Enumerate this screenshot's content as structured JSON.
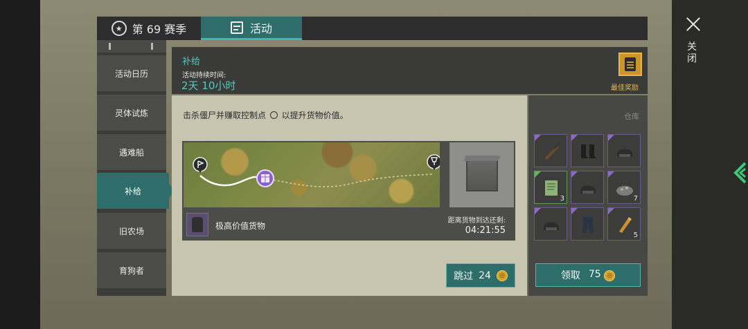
{
  "tabs": {
    "season_label": "第 69 赛季",
    "activity_label": "活动"
  },
  "sidebar": {
    "items": [
      {
        "label": "活动日历"
      },
      {
        "label": "灵体试炼"
      },
      {
        "label": "遇难船"
      },
      {
        "label": "补给"
      },
      {
        "label": "旧农场"
      },
      {
        "label": "育狗者"
      }
    ],
    "active": "补给"
  },
  "event": {
    "title": "补给",
    "duration_label": "活动持续时间:",
    "duration_value": "2天 10小时",
    "best_reward_label": "最佳奖励",
    "description_before": "击杀僵尸并赚取控制点",
    "description_after": "以提升货物价值。"
  },
  "cargo": {
    "label": "极高价值货物",
    "arrive_label": "距离货物到达还剩:",
    "arrive_time": "04:21:55"
  },
  "actions": {
    "skip_label": "跳过",
    "skip_cost": "24",
    "claim_label": "领取",
    "claim_cost": "75"
  },
  "warehouse": {
    "label": "仓库",
    "items": [
      {
        "icon": "rifle-icon",
        "qty": ""
      },
      {
        "icon": "boots-icon",
        "qty": ""
      },
      {
        "icon": "helmet-icon",
        "qty": ""
      },
      {
        "icon": "notebook-icon",
        "qty": "3"
      },
      {
        "icon": "helmet-icon",
        "qty": ""
      },
      {
        "icon": "gravel-icon",
        "qty": "7"
      },
      {
        "icon": "helmet-icon",
        "qty": ""
      },
      {
        "icon": "pants-icon",
        "qty": ""
      },
      {
        "icon": "ammo-icon",
        "qty": "5"
      }
    ]
  },
  "window": {
    "close_label": "关闭"
  },
  "colors": {
    "accent": "#2f6d6a",
    "accent_text": "#55c7bd",
    "reward_gold": "#c9962a",
    "rarity_purple": "#8d69c4"
  }
}
